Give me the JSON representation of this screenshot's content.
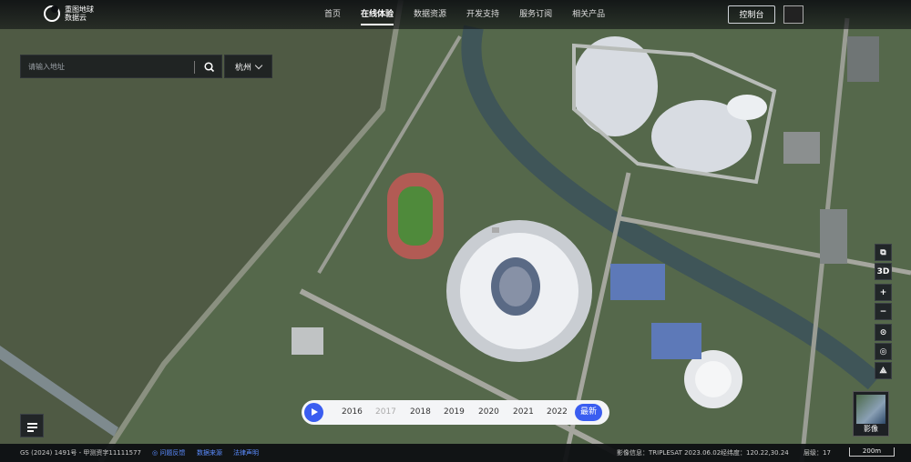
{
  "logo": {
    "text_line1": "重图地球",
    "text_line2": "数据云"
  },
  "nav": {
    "items": [
      {
        "label": "首页"
      },
      {
        "label": "在线体验"
      },
      {
        "label": "数据资源"
      },
      {
        "label": "开发支持"
      },
      {
        "label": "服务订阅"
      },
      {
        "label": "相关产品"
      }
    ],
    "active": "在线体验",
    "console_label": "控制台"
  },
  "search": {
    "placeholder": "请输入地址",
    "icon": "search-icon"
  },
  "city_select": {
    "value": "杭州"
  },
  "map_tools": [
    {
      "icon": "layers-icon",
      "label": "⧉"
    },
    {
      "icon": "3d-icon",
      "label": "3D"
    },
    {
      "icon": "zoom-in-icon",
      "label": "+"
    },
    {
      "icon": "zoom-out-icon",
      "label": "−"
    },
    {
      "icon": "location-pin-icon",
      "label": "⊙"
    },
    {
      "icon": "locate-icon",
      "label": "◎"
    },
    {
      "icon": "measure-icon",
      "label": "⟁"
    }
  ],
  "layer_switch": {
    "label": "影像"
  },
  "timeline": {
    "years": [
      "2016",
      "2017",
      "2018",
      "2019",
      "2020",
      "2021",
      "2022"
    ],
    "disabled": [
      "2017"
    ],
    "latest_label": "最新"
  },
  "footer": {
    "license": "GS (2024) 1491号 - 甲测资字11111577",
    "links": [
      "问题反馈",
      "数据来源",
      "法律声明"
    ],
    "image_info": "影像信息：TRIPLESAT 2023.06.02",
    "coordinates": "经纬度：120.22,30.24",
    "level": "层级：17",
    "scale": "200m"
  },
  "colors": {
    "accent": "#3a5df0",
    "link": "#5b8cff"
  }
}
